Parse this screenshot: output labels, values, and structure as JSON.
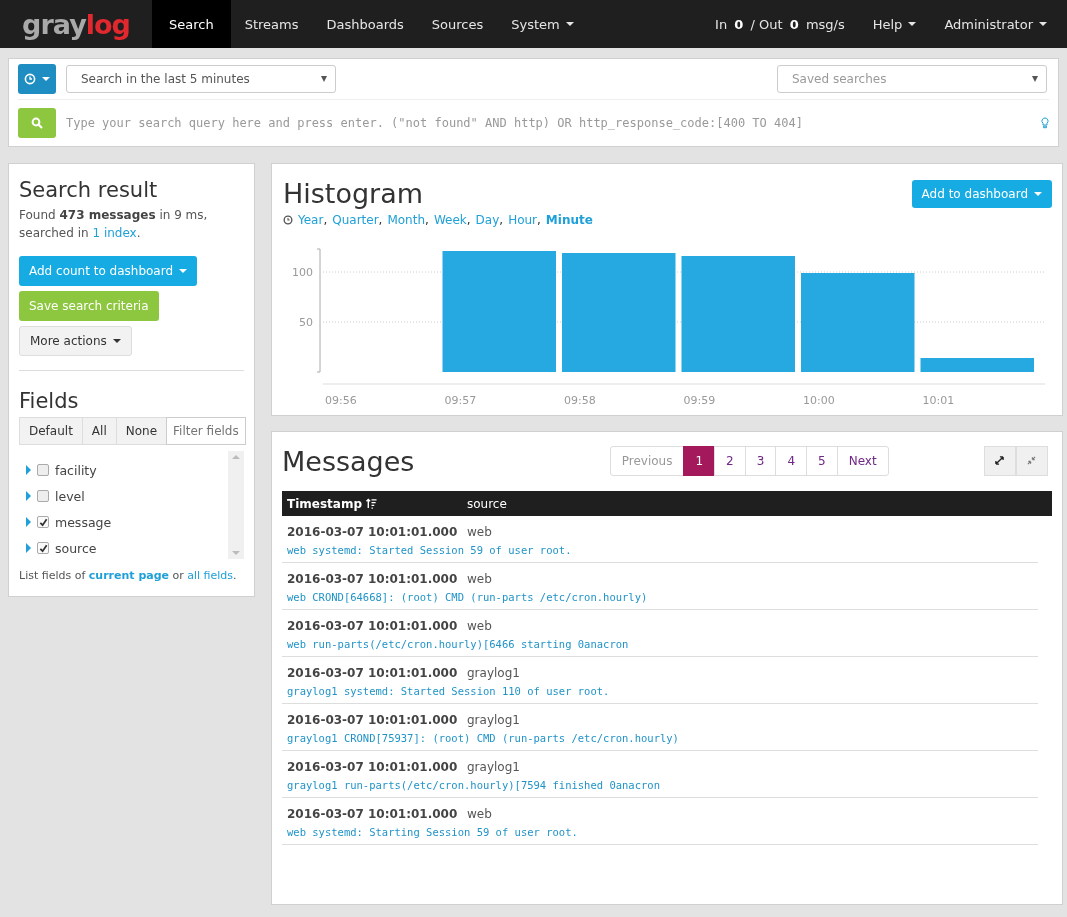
{
  "navbar": {
    "logo": "graylog",
    "items": [
      {
        "label": "Search",
        "selected": true,
        "dropdown": false
      },
      {
        "label": "Streams",
        "selected": false,
        "dropdown": false
      },
      {
        "label": "Dashboards",
        "selected": false,
        "dropdown": false
      },
      {
        "label": "Sources",
        "selected": false,
        "dropdown": false
      },
      {
        "label": "System",
        "selected": false,
        "dropdown": true
      }
    ],
    "throughput": "In **0** / Out **0** msg/s",
    "menus": [
      "Help",
      "Administrator"
    ]
  },
  "search_bar": {
    "time_range": "Search in the last 5 minutes",
    "saved_searches": {
      "placeholder": "Saved searches"
    },
    "query": {
      "placeholder": "Type your search query here and press enter. (\"not found\" AND http) OR http_response_code:[400 TO 404]"
    }
  },
  "sidebar": {
    "title": "Search result",
    "summary": "Found **473 messages**  in 9 ms, searched in",
    "summary_link": "1 index",
    "summary_end": ".",
    "buttons": [
      {
        "label": "Add count to dashboard",
        "kind": "primary",
        "dropdown": true
      },
      {
        "label": "Save search criteria",
        "kind": "success",
        "dropdown": false
      },
      {
        "label": "More actions",
        "kind": "default",
        "dropdown": true
      }
    ],
    "fields_title": "Fields",
    "field_filters": [
      "Default",
      "All",
      "None"
    ],
    "field_filter": {
      "placeholder": "Filter fields"
    },
    "fields": [
      {
        "name": "facility",
        "checked": false
      },
      {
        "name": "level",
        "checked": false
      },
      {
        "name": "message",
        "checked": true
      },
      {
        "name": "source",
        "checked": true
      }
    ],
    "footer_text": "List fields of",
    "footer_links": [
      {
        "label": "current page",
        "selected": true
      },
      {
        "label": "all fields",
        "selected": false
      }
    ],
    "footer_joiner": "or",
    "footer_end": "."
  },
  "histogram": {
    "title": "Histogram",
    "add_button": "Add to dashboard",
    "resolutions": [
      {
        "label": "Year",
        "selected": false
      },
      {
        "label": "Quarter",
        "selected": false
      },
      {
        "label": "Month",
        "selected": false
      },
      {
        "label": "Week",
        "selected": false
      },
      {
        "label": "Day",
        "selected": false
      },
      {
        "label": "Hour",
        "selected": false
      },
      {
        "label": "Minute",
        "selected": true
      }
    ],
    "resolution_separator": ",",
    "chart_data": {
      "type": "bar",
      "categories": [
        "09:56",
        "09:57",
        "09:58",
        "09:59",
        "10:00",
        "10:01"
      ],
      "series": [
        {
          "color": "#26a9e0",
          "values": [
            0,
            121,
            119,
            116,
            99,
            14
          ]
        }
      ],
      "ylim": [
        0,
        123
      ],
      "yticks": [
        50,
        100
      ]
    }
  },
  "messages": {
    "title": "Messages",
    "pagination": [
      {
        "label": "Previous",
        "selected": false,
        "disabled": true
      },
      {
        "label": "1",
        "selected": true,
        "disabled": false
      },
      {
        "label": "2",
        "selected": false,
        "disabled": false
      },
      {
        "label": "3",
        "selected": false,
        "disabled": false
      },
      {
        "label": "4",
        "selected": false,
        "disabled": false
      },
      {
        "label": "5",
        "selected": false,
        "disabled": false
      },
      {
        "label": "Next",
        "selected": false,
        "disabled": false
      }
    ],
    "columns": [
      "Timestamp",
      "source"
    ],
    "rows": [
      {
        "timestamp": "2016-03-07 10:01:01.000",
        "source": "web",
        "message": "web systemd: Started Session 59 of user root."
      },
      {
        "timestamp": "2016-03-07 10:01:01.000",
        "source": "web",
        "message": "web CROND[64668]: (root) CMD (run-parts /etc/cron.hourly)"
      },
      {
        "timestamp": "2016-03-07 10:01:01.000",
        "source": "web",
        "message": "web run-parts(/etc/cron.hourly)[6466 starting 0anacron"
      },
      {
        "timestamp": "2016-03-07 10:01:01.000",
        "source": "graylog1",
        "message": "graylog1 systemd: Started Session 110 of user root."
      },
      {
        "timestamp": "2016-03-07 10:01:01.000",
        "source": "graylog1",
        "message": "graylog1 CROND[75937]: (root) CMD (run-parts /etc/cron.hourly)"
      },
      {
        "timestamp": "2016-03-07 10:01:01.000",
        "source": "graylog1",
        "message": "graylog1 run-parts(/etc/cron.hourly)[7594 finished 0anacron"
      },
      {
        "timestamp": "2016-03-07 10:01:01.000",
        "source": "web",
        "message": "web systemd: Starting Session 59 of user root."
      }
    ]
  }
}
